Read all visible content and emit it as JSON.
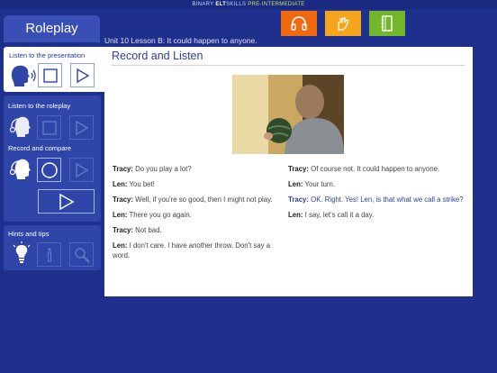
{
  "header": {
    "brand_prefix": "BINARY",
    "brand_elt": "ELT",
    "brand_suffix": "SKILLS",
    "level": "PRE-INTERMEDIATE"
  },
  "top_buttons": [
    {
      "name": "headphones",
      "color": "#f26a0f"
    },
    {
      "name": "hand",
      "color": "#f5a51b"
    },
    {
      "name": "notebook",
      "color": "#73b52b"
    }
  ],
  "sidebar": {
    "title": "Roleplay",
    "presentation_label": "Listen to the presentation",
    "roleplay_label": "Listen to the roleplay",
    "record_label": "Record and compare",
    "hints_label": "Hints and tips"
  },
  "lesson": {
    "title": "Unit 10 Lesson B: It could happen to anyone.",
    "section_title": "Record and Listen"
  },
  "dialog_left": [
    {
      "speaker": "Tracy:",
      "text": "Do you play a lot?"
    },
    {
      "speaker": "Len:",
      "text": "You bet!"
    },
    {
      "speaker": "Tracy:",
      "text": "Well, if you're so good, then I might not play."
    },
    {
      "speaker": "Len:",
      "text": "There you go again."
    },
    {
      "speaker": "Tracy:",
      "text": "Not bad."
    },
    {
      "speaker": "Len:",
      "text": "I don't care. I have another throw. Don't say a word."
    }
  ],
  "dialog_right": [
    {
      "speaker": "Tracy:",
      "text": "Of course not. It could happen to anyone."
    },
    {
      "speaker": "Len:",
      "text": "Your turn."
    },
    {
      "speaker": "Tracy:",
      "text": "OK. Right. Yes! Len, is that what we call a strike?"
    },
    {
      "speaker": "Len:",
      "text": "I say, let's call it a day."
    }
  ],
  "colors": {
    "background": "#1e2f8c",
    "accent_blue": "#2b3f9c",
    "highlight_line": "#2b3f9c"
  }
}
